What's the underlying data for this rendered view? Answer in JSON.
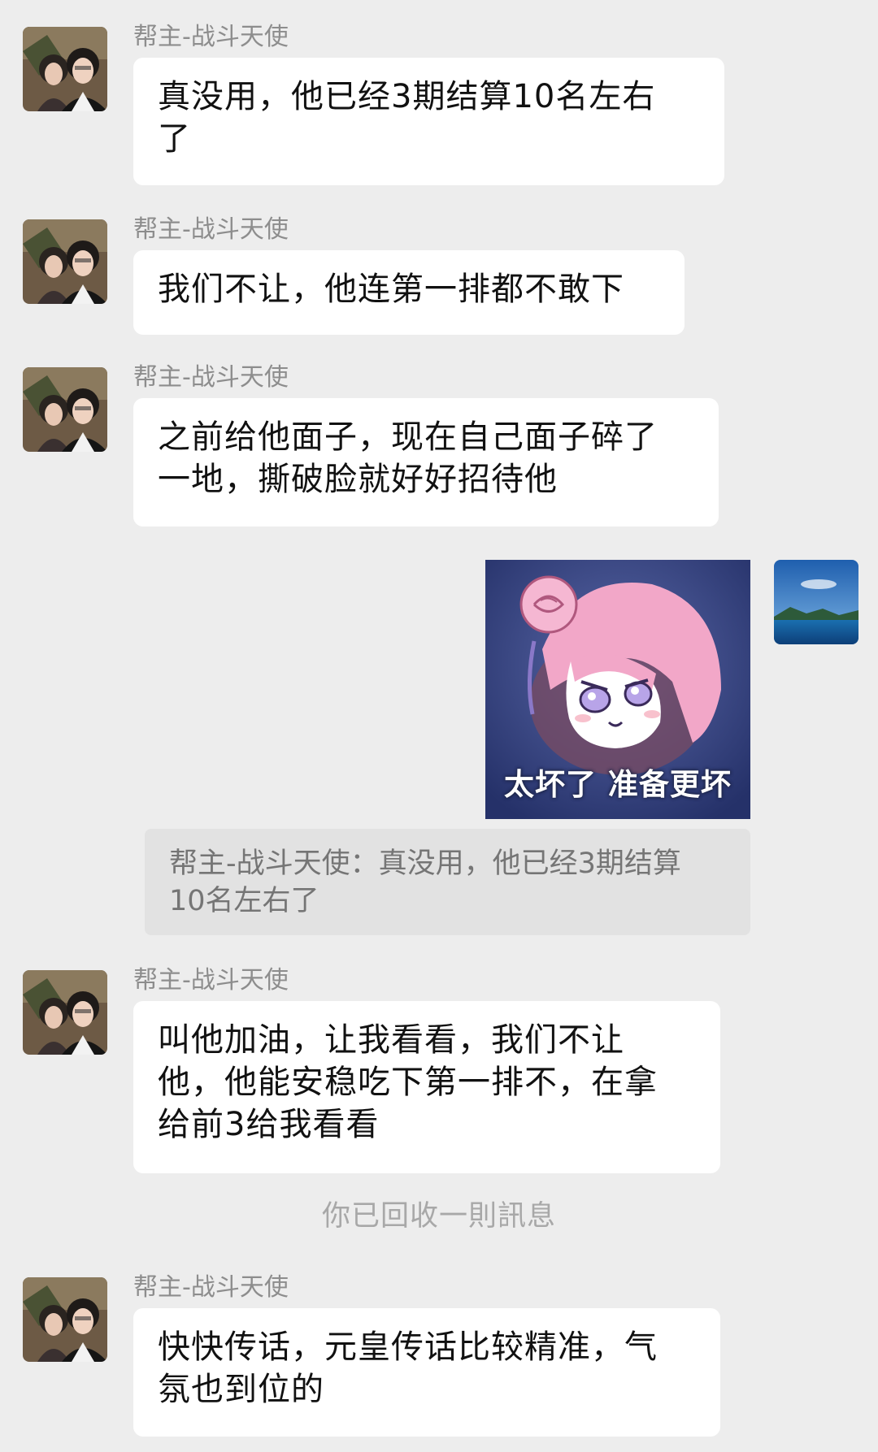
{
  "messages": [
    {
      "sender": "帮主-战斗天使",
      "lines": [
        "真没用，他已经3期结算10名左右",
        "了"
      ]
    },
    {
      "sender": "帮主-战斗天使",
      "lines": [
        "我们不让，他连第一排都不敢下"
      ]
    },
    {
      "sender": "帮主-战斗天使",
      "lines": [
        "之前给他面子，现在自己面子碎了",
        "一地，撕破脸就好好招待他"
      ]
    },
    {
      "sender": "帮主-战斗天使",
      "lines": [
        "叫他加油，让我看看，我们不让",
        "他，他能安稳吃下第一排不，在拿",
        "给前3给我看看"
      ]
    },
    {
      "sender": "帮主-战斗天使",
      "lines": [
        "快快传话，元皇传话比较精准，气",
        "氛也到位的"
      ]
    }
  ],
  "self_sticker": {
    "caption": "太坏了 准备更坏",
    "icon": "pink-hair-anime-girl-sticker"
  },
  "quote": {
    "lines": [
      "帮主-战斗天使：真没用，他已经3期结算",
      "10名左右了"
    ]
  },
  "system_note": "你已回收一則訊息",
  "avatars": {
    "contact": "couple-photo-avatar",
    "self": "sea-landscape-avatar"
  },
  "colors": {
    "background": "#ededed",
    "bubble": "#ffffff",
    "sender_text": "#8d8d8d",
    "quote_background": "#e2e2e2"
  }
}
